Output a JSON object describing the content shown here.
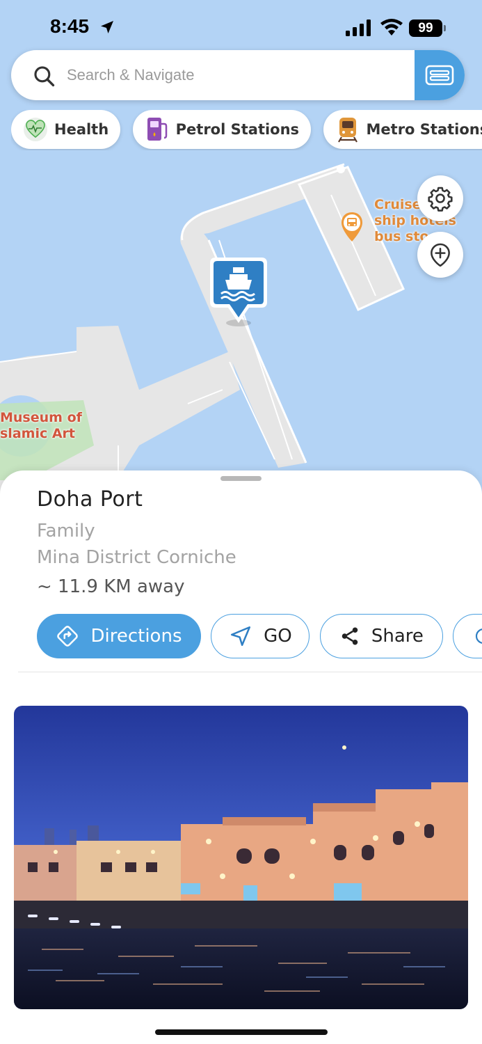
{
  "status_bar": {
    "time": "8:45",
    "battery": "99"
  },
  "search": {
    "placeholder": "Search & Navigate"
  },
  "categories": [
    {
      "label": "Health",
      "icon": "heart-pulse-icon"
    },
    {
      "label": "Petrol Stations",
      "icon": "fuel-pump-icon"
    },
    {
      "label": "Metro Stations",
      "icon": "train-icon"
    }
  ],
  "map": {
    "labels": {
      "museum_line1": "Museum of",
      "museum_line2": "slamic Art",
      "cruise_line1": "Cruise",
      "cruise_line2": "ship hotels",
      "cruise_line3": "bus sto"
    }
  },
  "place": {
    "name": "Doha Port",
    "category": "Family",
    "area": "Mina District Corniche",
    "distance": "~ 11.9 KM away"
  },
  "actions": {
    "directions": "Directions",
    "go": "GO",
    "share": "Share"
  },
  "colors": {
    "accent": "#4ba0e0",
    "water": "#b3d3f5",
    "land": "#e6e6e6",
    "park": "#bfe3b8"
  }
}
